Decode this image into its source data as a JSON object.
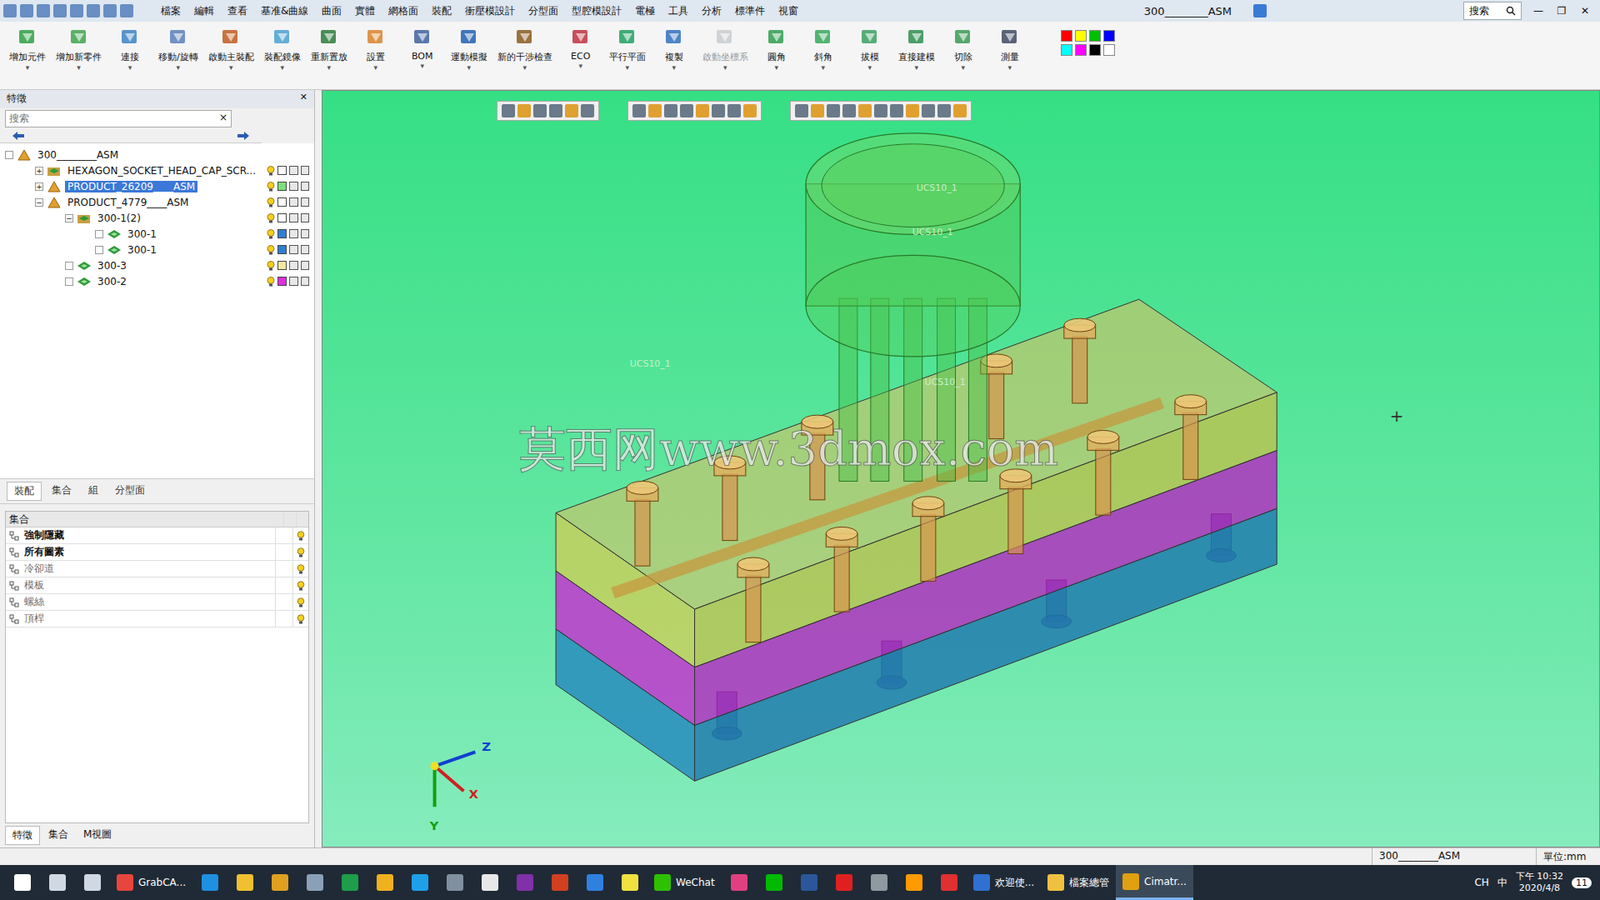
{
  "window": {
    "title": "300________ASM",
    "search_placeholder": "搜索",
    "controls": [
      "—",
      "❐",
      "✕"
    ]
  },
  "menu": [
    "檔案",
    "編輯",
    "查看",
    "基准&曲線",
    "曲面",
    "實體",
    "網格面",
    "裝配",
    "衝壓模設計",
    "分型面",
    "型腔模設計",
    "電極",
    "工具",
    "分析",
    "標準件",
    "視窗"
  ],
  "ribbon": [
    {
      "label": "增加元件",
      "disabled": false
    },
    {
      "label": "增加新零件",
      "disabled": false
    },
    {
      "label": "連接",
      "disabled": false
    },
    {
      "label": "移動/旋轉",
      "disabled": false
    },
    {
      "label": "啟動主裝配",
      "disabled": false
    },
    {
      "label": "裝配鏡像",
      "disabled": false
    },
    {
      "label": "重新置放",
      "disabled": false
    },
    {
      "label": "設置",
      "disabled": false
    },
    {
      "label": "BOM",
      "disabled": false
    },
    {
      "label": "運動模擬",
      "disabled": false
    },
    {
      "label": "新的干涉檢查",
      "disabled": false
    },
    {
      "label": "ECO",
      "disabled": false
    },
    {
      "label": "平行平面",
      "disabled": false
    },
    {
      "label": "複製",
      "disabled": false
    },
    {
      "label": "啟動坐標系",
      "disabled": true
    },
    {
      "label": "圓角",
      "disabled": false
    },
    {
      "label": "斜角",
      "disabled": false
    },
    {
      "label": "拔模",
      "disabled": false
    },
    {
      "label": "直接建模",
      "disabled": false
    },
    {
      "label": "切除",
      "disabled": false
    },
    {
      "label": "測量",
      "disabled": false
    }
  ],
  "palette": [
    {
      "color": "#ff0000"
    },
    {
      "color": "#ffff00"
    },
    {
      "color": "#00c000"
    },
    {
      "color": "#0000ff"
    },
    {
      "color": "#00ffff"
    },
    {
      "color": "#ff00ff"
    },
    {
      "color": "#000000"
    },
    {
      "color": "#ffffff"
    }
  ],
  "feature_panel": {
    "title": "特徵",
    "close": "✕",
    "search_placeholder": "搜索",
    "clear": "×",
    "tree": [
      {
        "label": "300________ASM",
        "depth": 0,
        "kind": "assembly",
        "selected": false
      },
      {
        "label": "HEXAGON_SOCKET_HEAD_CAP_SCR...",
        "depth": 1,
        "kind": "group",
        "toggle": "+",
        "expanded": false,
        "selected": false
      },
      {
        "label": "PRODUCT_26209____ASM",
        "depth": 1,
        "kind": "assembly",
        "toggle": "+",
        "expanded": false,
        "selected": true,
        "color": "#7be07b"
      },
      {
        "label": "PRODUCT_4779____ASM",
        "depth": 1,
        "kind": "assembly",
        "toggle": "−",
        "expanded": true,
        "selected": false
      },
      {
        "label": "300-1(2)",
        "depth": 2,
        "kind": "group",
        "toggle": "−",
        "expanded": true,
        "selected": false
      },
      {
        "label": "300-1",
        "depth": 3,
        "kind": "part",
        "selected": false,
        "color": "#2f7fd0"
      },
      {
        "label": "300-1",
        "depth": 3,
        "kind": "part",
        "selected": false,
        "color": "#2f7fd0"
      },
      {
        "label": "300-3",
        "depth": 2,
        "kind": "part",
        "selected": false,
        "color": "#f3e8a0"
      },
      {
        "label": "300-2",
        "depth": 2,
        "kind": "part",
        "selected": false,
        "color": "#e02ee0"
      }
    ]
  },
  "panel_tabs": [
    {
      "label": "裝配",
      "selected": true
    },
    {
      "label": "集合",
      "selected": false
    },
    {
      "label": "組",
      "selected": false
    },
    {
      "label": "分型面",
      "selected": false
    }
  ],
  "sets": {
    "header": "集合",
    "rows": [
      {
        "label": "強制隱藏",
        "bold": true,
        "disabled": false
      },
      {
        "label": "所有圖素",
        "bold": true,
        "disabled": false
      },
      {
        "label": "冷卻道",
        "bold": false,
        "disabled": true
      },
      {
        "label": "模板",
        "bold": false,
        "disabled": true
      },
      {
        "label": "螺絲",
        "bold": false,
        "disabled": true
      },
      {
        "label": "頂桿",
        "bold": false,
        "disabled": true
      }
    ]
  },
  "bottom_tabs": [
    {
      "label": "特徵",
      "selected": true
    },
    {
      "label": "集合",
      "selected": false
    },
    {
      "label": "M視圖",
      "selected": false
    }
  ],
  "viewport": {
    "watermark": "莫西网www.3dmox.com",
    "labels": [
      "UCS10_1",
      "UCS10_1",
      "UCS10_1",
      "UCS10_1"
    ],
    "axes": [
      "Z",
      "X",
      "Y"
    ]
  },
  "status_bar": {
    "model": "300________ASM",
    "units": "單位:mm"
  },
  "taskbar": {
    "apps": [
      {
        "color": "#ffffff",
        "active": false
      },
      {
        "color": "#cfd8e3",
        "active": false
      },
      {
        "color": "#cfd8e3",
        "active": false
      },
      {
        "label": "GrabCA...",
        "color": "#e8453c",
        "active": false
      },
      {
        "color": "#1f8fe0",
        "active": false
      },
      {
        "color": "#f0c030",
        "active": false
      },
      {
        "color": "#e0a020",
        "active": false
      },
      {
        "color": "#8aa0b8",
        "active": false
      },
      {
        "color": "#1e9e4a",
        "active": false
      },
      {
        "color": "#f0b020",
        "active": false
      },
      {
        "color": "#1ea0e8",
        "active": false
      },
      {
        "color": "#8090a0",
        "active": false
      },
      {
        "color": "#e8e8e8",
        "active": false
      },
      {
        "color": "#8030a8",
        "active": false
      },
      {
        "color": "#d04020",
        "active": false
      },
      {
        "color": "#3080e0",
        "active": false
      },
      {
        "color": "#f0e040",
        "active": false
      },
      {
        "label": "WeChat",
        "color": "#2dc100",
        "active": false
      },
      {
        "color": "#e04080",
        "active": false
      },
      {
        "color": "#00b900",
        "active": false
      },
      {
        "color": "#2b579a",
        "active": false
      },
      {
        "color": "#e02020",
        "active": false
      },
      {
        "color": "#9098a0",
        "active": false
      },
      {
        "color": "#ff9a00",
        "active": false
      },
      {
        "color": "#e03030",
        "active": false
      },
      {
        "label": "欢迎使...",
        "color": "#3070d0",
        "active": false
      },
      {
        "label": "檔案總管",
        "color": "#f0c040",
        "active": false
      },
      {
        "label": "Cimatr...",
        "color": "#e0a010",
        "active": true
      }
    ],
    "tray": [
      "CH",
      "中"
    ],
    "time": "下午 10:32",
    "date": "2020/4/8",
    "notifications": "11"
  }
}
